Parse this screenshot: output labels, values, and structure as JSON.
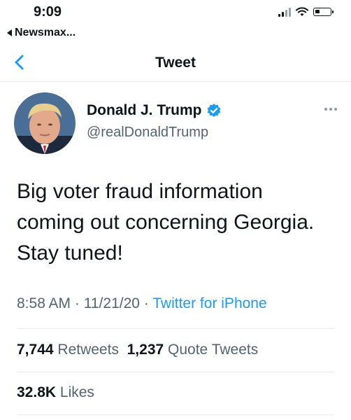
{
  "status_bar": {
    "time": "9:09",
    "back_app": "Newsmax..."
  },
  "nav": {
    "title": "Tweet"
  },
  "author": {
    "display_name": "Donald J. Trump",
    "handle": "@realDonaldTrump",
    "verified": true
  },
  "tweet": {
    "text_lines": [
      "Big voter fraud information",
      "coming out concerning Georgia.",
      "Stay tuned!"
    ],
    "time": "8:58 AM",
    "date": "11/21/20",
    "separator": "·",
    "source": "Twitter for iPhone"
  },
  "stats": {
    "retweets_count": "7,744",
    "retweets_label": "Retweets",
    "quote_count": "1,237",
    "quote_label": "Quote Tweets",
    "likes_count": "32.8K",
    "likes_label": "Likes"
  },
  "colors": {
    "accent": "#1d9bf0",
    "secondary_text": "#536471",
    "divider": "#e6ecf0"
  }
}
